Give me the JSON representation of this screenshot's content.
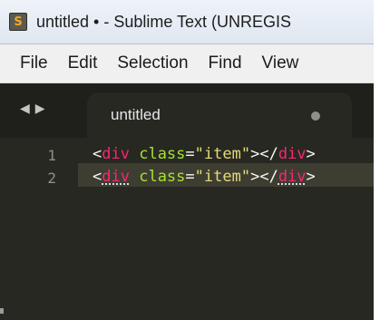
{
  "window": {
    "title": "untitled • - Sublime Text (UNREGIS",
    "icon": "sublime-text-app-icon",
    "icon_glyph": "S"
  },
  "menu": [
    "File",
    "Edit",
    "Selection",
    "Find",
    "View"
  ],
  "tabbar": {
    "back_glyph": "◀",
    "forward_glyph": "▶",
    "tab_label": "untitled"
  },
  "editor": {
    "line_numbers": [
      "1",
      "2"
    ],
    "lines": [
      {
        "lt": "<",
        "tag_open": "div",
        "attr": "class",
        "eq": "=",
        "value": "\"item\"",
        "gt": ">",
        "close_lt": "</",
        "tag_close": "div",
        "close_gt": ">"
      },
      {
        "lt": "<",
        "tag_open": "div",
        "attr": "class",
        "eq": "=",
        "value": "\"item\"",
        "gt": ">",
        "close_lt": "</",
        "tag_close": "div",
        "close_gt": ">"
      }
    ]
  },
  "colors": {
    "background": "#272822",
    "tag": "#f92672",
    "attribute": "#a6e22e",
    "string": "#e6db74",
    "punctuation": "#f8f8f2",
    "line_number": "#8f908a",
    "active_line": "#3e3d32"
  }
}
